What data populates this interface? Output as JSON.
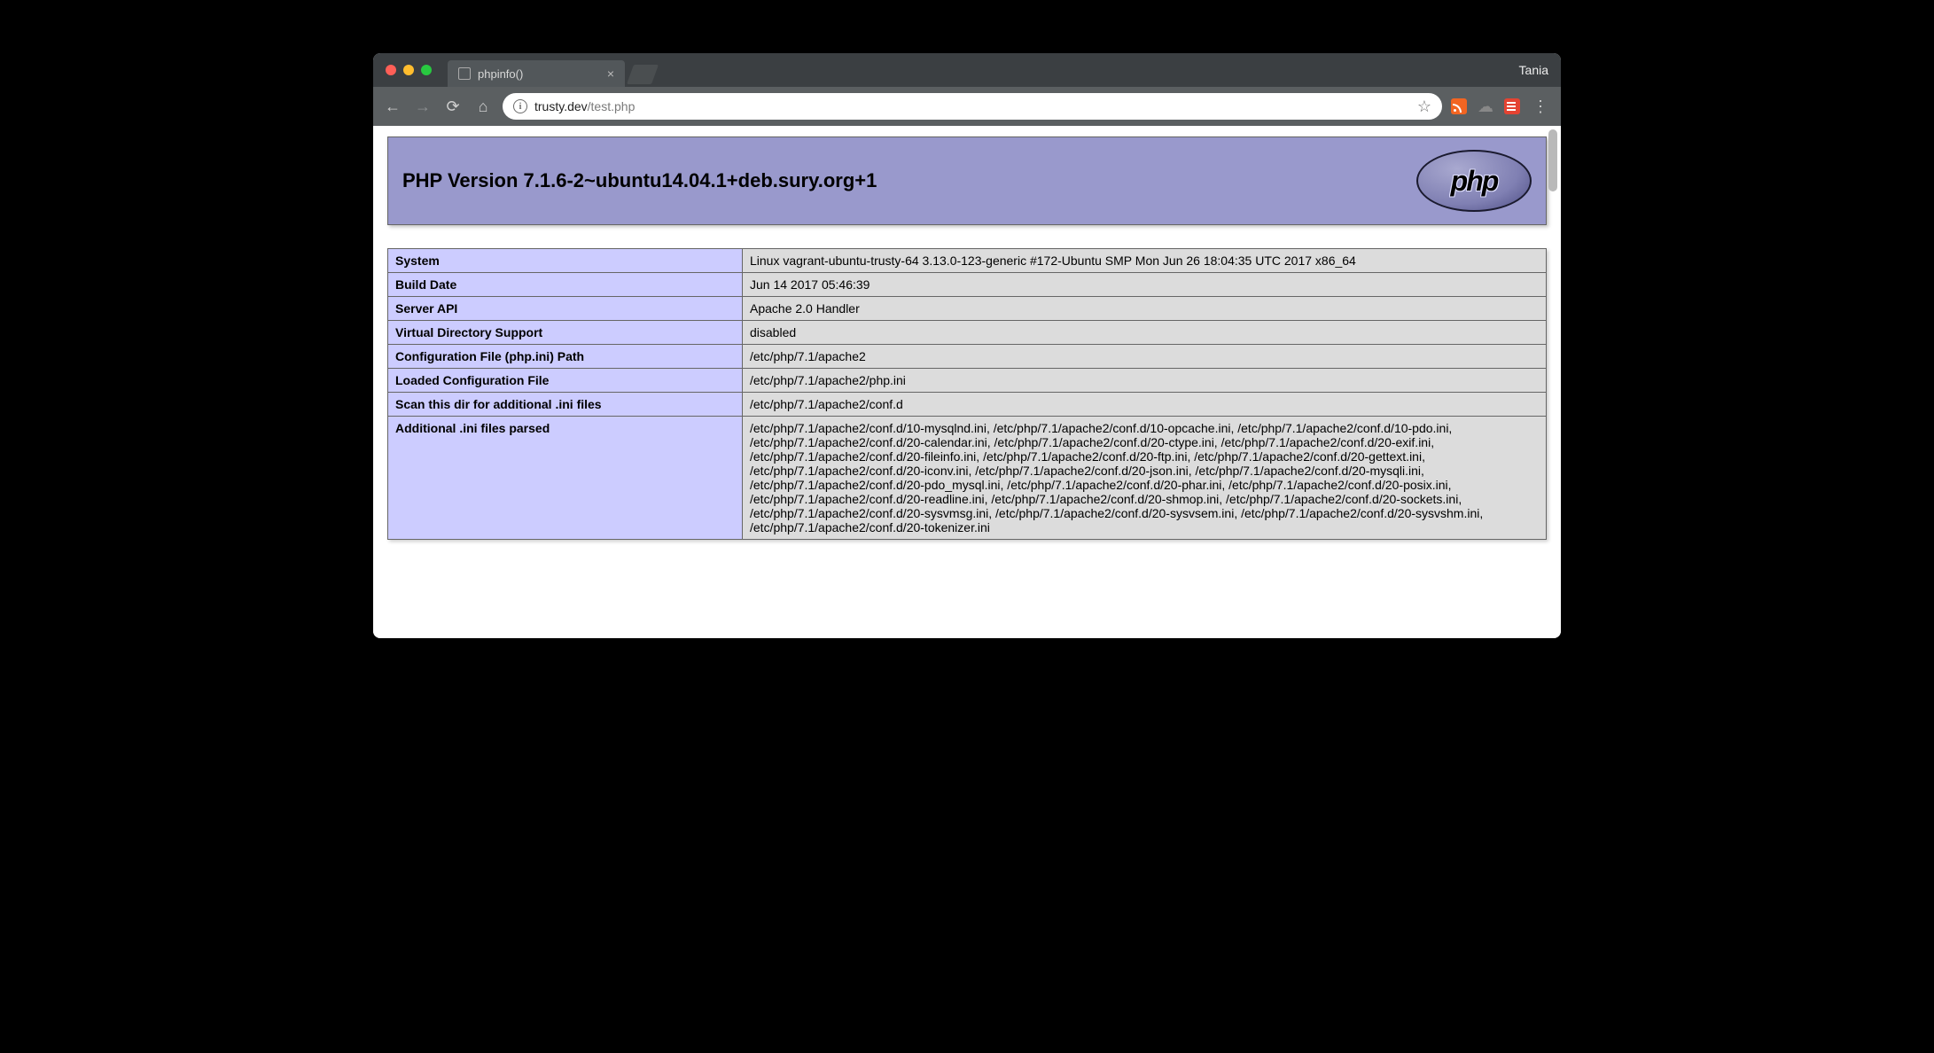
{
  "browser": {
    "tab_title": "phpinfo()",
    "profile_name": "Tania",
    "url_host": "trusty.dev",
    "url_path": "/test.php"
  },
  "page": {
    "title": "PHP Version 7.1.6-2~ubuntu14.04.1+deb.sury.org+1",
    "logo_text": "php",
    "rows": [
      {
        "key": "System",
        "value": "Linux vagrant-ubuntu-trusty-64 3.13.0-123-generic #172-Ubuntu SMP Mon Jun 26 18:04:35 UTC 2017 x86_64"
      },
      {
        "key": "Build Date",
        "value": "Jun 14 2017 05:46:39"
      },
      {
        "key": "Server API",
        "value": "Apache 2.0 Handler"
      },
      {
        "key": "Virtual Directory Support",
        "value": "disabled"
      },
      {
        "key": "Configuration File (php.ini) Path",
        "value": "/etc/php/7.1/apache2"
      },
      {
        "key": "Loaded Configuration File",
        "value": "/etc/php/7.1/apache2/php.ini"
      },
      {
        "key": "Scan this dir for additional .ini files",
        "value": "/etc/php/7.1/apache2/conf.d"
      },
      {
        "key": "Additional .ini files parsed",
        "value": "/etc/php/7.1/apache2/conf.d/10-mysqlnd.ini, /etc/php/7.1/apache2/conf.d/10-opcache.ini, /etc/php/7.1/apache2/conf.d/10-pdo.ini, /etc/php/7.1/apache2/conf.d/20-calendar.ini, /etc/php/7.1/apache2/conf.d/20-ctype.ini, /etc/php/7.1/apache2/conf.d/20-exif.ini, /etc/php/7.1/apache2/conf.d/20-fileinfo.ini, /etc/php/7.1/apache2/conf.d/20-ftp.ini, /etc/php/7.1/apache2/conf.d/20-gettext.ini, /etc/php/7.1/apache2/conf.d/20-iconv.ini, /etc/php/7.1/apache2/conf.d/20-json.ini, /etc/php/7.1/apache2/conf.d/20-mysqli.ini, /etc/php/7.1/apache2/conf.d/20-pdo_mysql.ini, /etc/php/7.1/apache2/conf.d/20-phar.ini, /etc/php/7.1/apache2/conf.d/20-posix.ini, /etc/php/7.1/apache2/conf.d/20-readline.ini, /etc/php/7.1/apache2/conf.d/20-shmop.ini, /etc/php/7.1/apache2/conf.d/20-sockets.ini, /etc/php/7.1/apache2/conf.d/20-sysvmsg.ini, /etc/php/7.1/apache2/conf.d/20-sysvsem.ini, /etc/php/7.1/apache2/conf.d/20-sysvshm.ini, /etc/php/7.1/apache2/conf.d/20-tokenizer.ini"
      }
    ]
  }
}
